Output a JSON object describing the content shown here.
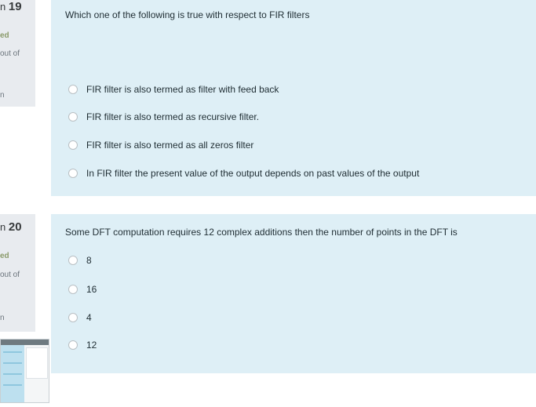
{
  "q19": {
    "number_prefix": "n",
    "number": "19",
    "status_fragment": "ed",
    "marks_fragment": "out of",
    "flag_fragment": "n",
    "text": "Which one of the following is  true with respect to FIR filters",
    "options": [
      "FIR filter is also termed as filter with feed back",
      "FIR filter is  also termed as recursive filter.",
      "FIR filter is also termed as all zeros filter",
      "In FIR filter the present value of the output  depends on past values of the output"
    ]
  },
  "q20": {
    "number_prefix": "n",
    "number": "20",
    "status_fragment": "ed",
    "marks_fragment": "out of",
    "flag_fragment": "n",
    "text": "Some DFT computation requires 12 complex additions then the number of points in the DFT is",
    "options": [
      "8",
      "16",
      "4",
      "12"
    ]
  },
  "colors": {
    "info_bg": "#e8ebef",
    "question_bg": "#deeff6",
    "text": "#1f2d33"
  }
}
